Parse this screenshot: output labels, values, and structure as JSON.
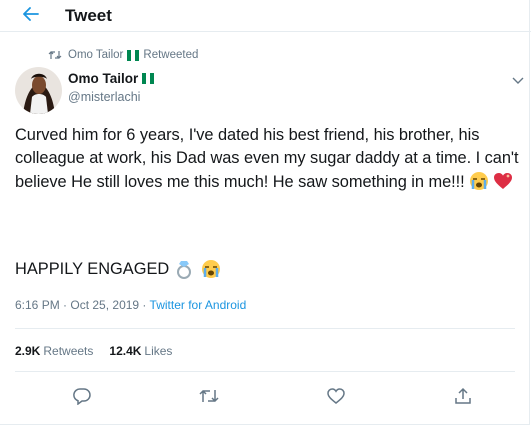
{
  "header": {
    "title": "Tweet"
  },
  "retweet": {
    "user": "Omo Tailor",
    "label": "Retweeted"
  },
  "tweet": {
    "author_name": "Omo Tailor",
    "handle": "@misterlachi",
    "text": "Curved him for 6 years, I've dated his best friend, his brother, his colleague at work, his Dad was even my sugar daddy at a time. I can't believe He still loves me this much! He saw something in me!!!",
    "engaged": "HAPPILY ENGAGED",
    "time": "6:16 PM",
    "date": "Oct 25, 2019",
    "source": "Twitter for Android"
  },
  "stats": {
    "retweets_count": "2.9K",
    "retweets_label": "Retweets",
    "likes_count": "12.4K",
    "likes_label": "Likes"
  },
  "colors": {
    "accent": "#1b95e0",
    "muted": "#657786",
    "flag_green": "#008751"
  }
}
